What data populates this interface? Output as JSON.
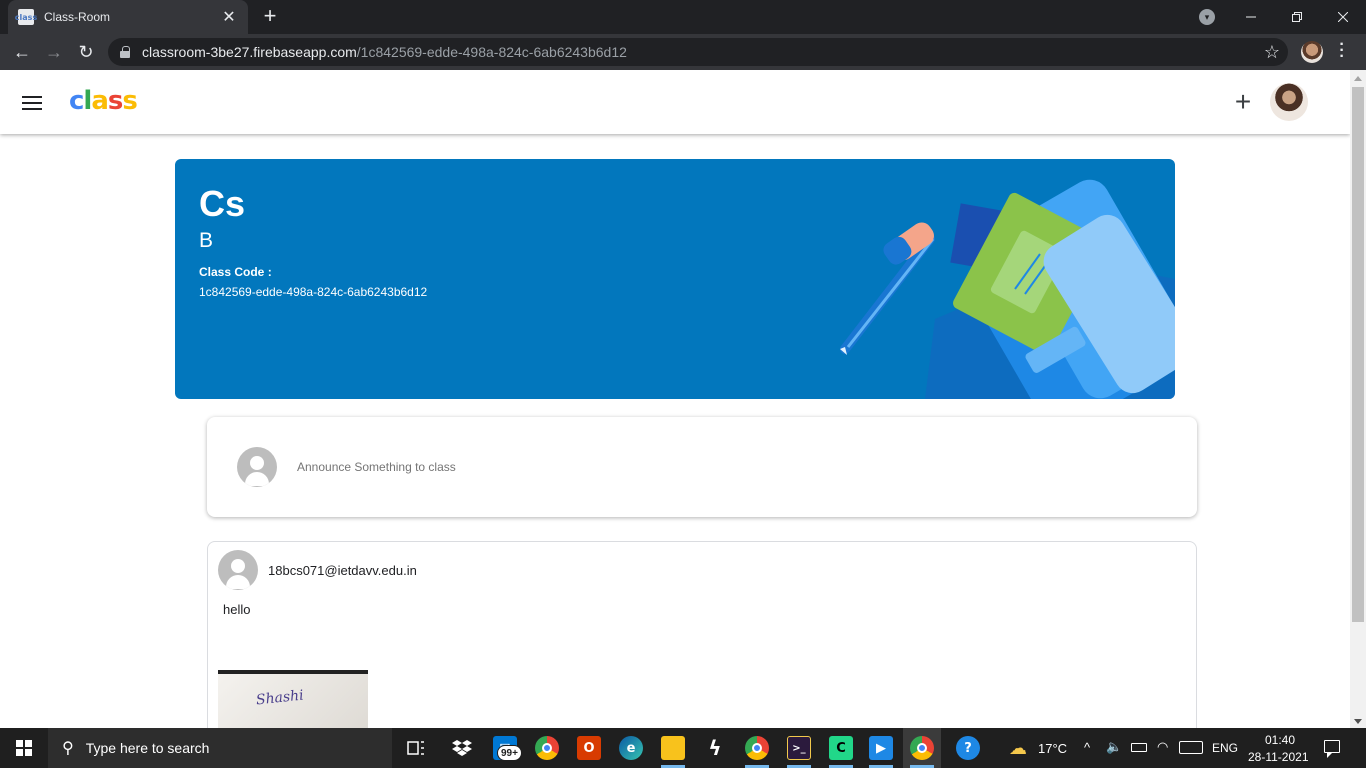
{
  "browser": {
    "tab_title": "Class-Room",
    "tab_favicon_text": "class",
    "url_host": "classroom-3be27.firebaseapp.com",
    "url_path": "/1c842569-edde-498a-824c-6ab6243b6d12"
  },
  "app": {
    "logo_letters": [
      {
        "char": "c",
        "color": "#4285f4"
      },
      {
        "char": "l",
        "color": "#34a853"
      },
      {
        "char": "a",
        "color": "#fbbc05"
      },
      {
        "char": "s",
        "color": "#ea4335"
      },
      {
        "char": "s",
        "color": "#fbbc05"
      }
    ],
    "add_icon": "plus-icon",
    "menu_icon": "hamburger-menu-icon"
  },
  "banner": {
    "class_name": "Cs",
    "section": "B",
    "code_label": "Class Code :",
    "code_value": "1c842569-edde-498a-824c-6ab6243b6d12",
    "background_color": "#0277bd"
  },
  "announce": {
    "placeholder": "Announce Something to class"
  },
  "posts": [
    {
      "author": "18bcs071@ietdavv.edu.in",
      "text": "hello",
      "image_signature": "Shashi"
    }
  ],
  "taskbar": {
    "search_placeholder": "Type here to search",
    "mail_badge": "99+",
    "weather": "17°C",
    "language": "ENG",
    "time": "01:40",
    "date": "28-11-2021"
  }
}
